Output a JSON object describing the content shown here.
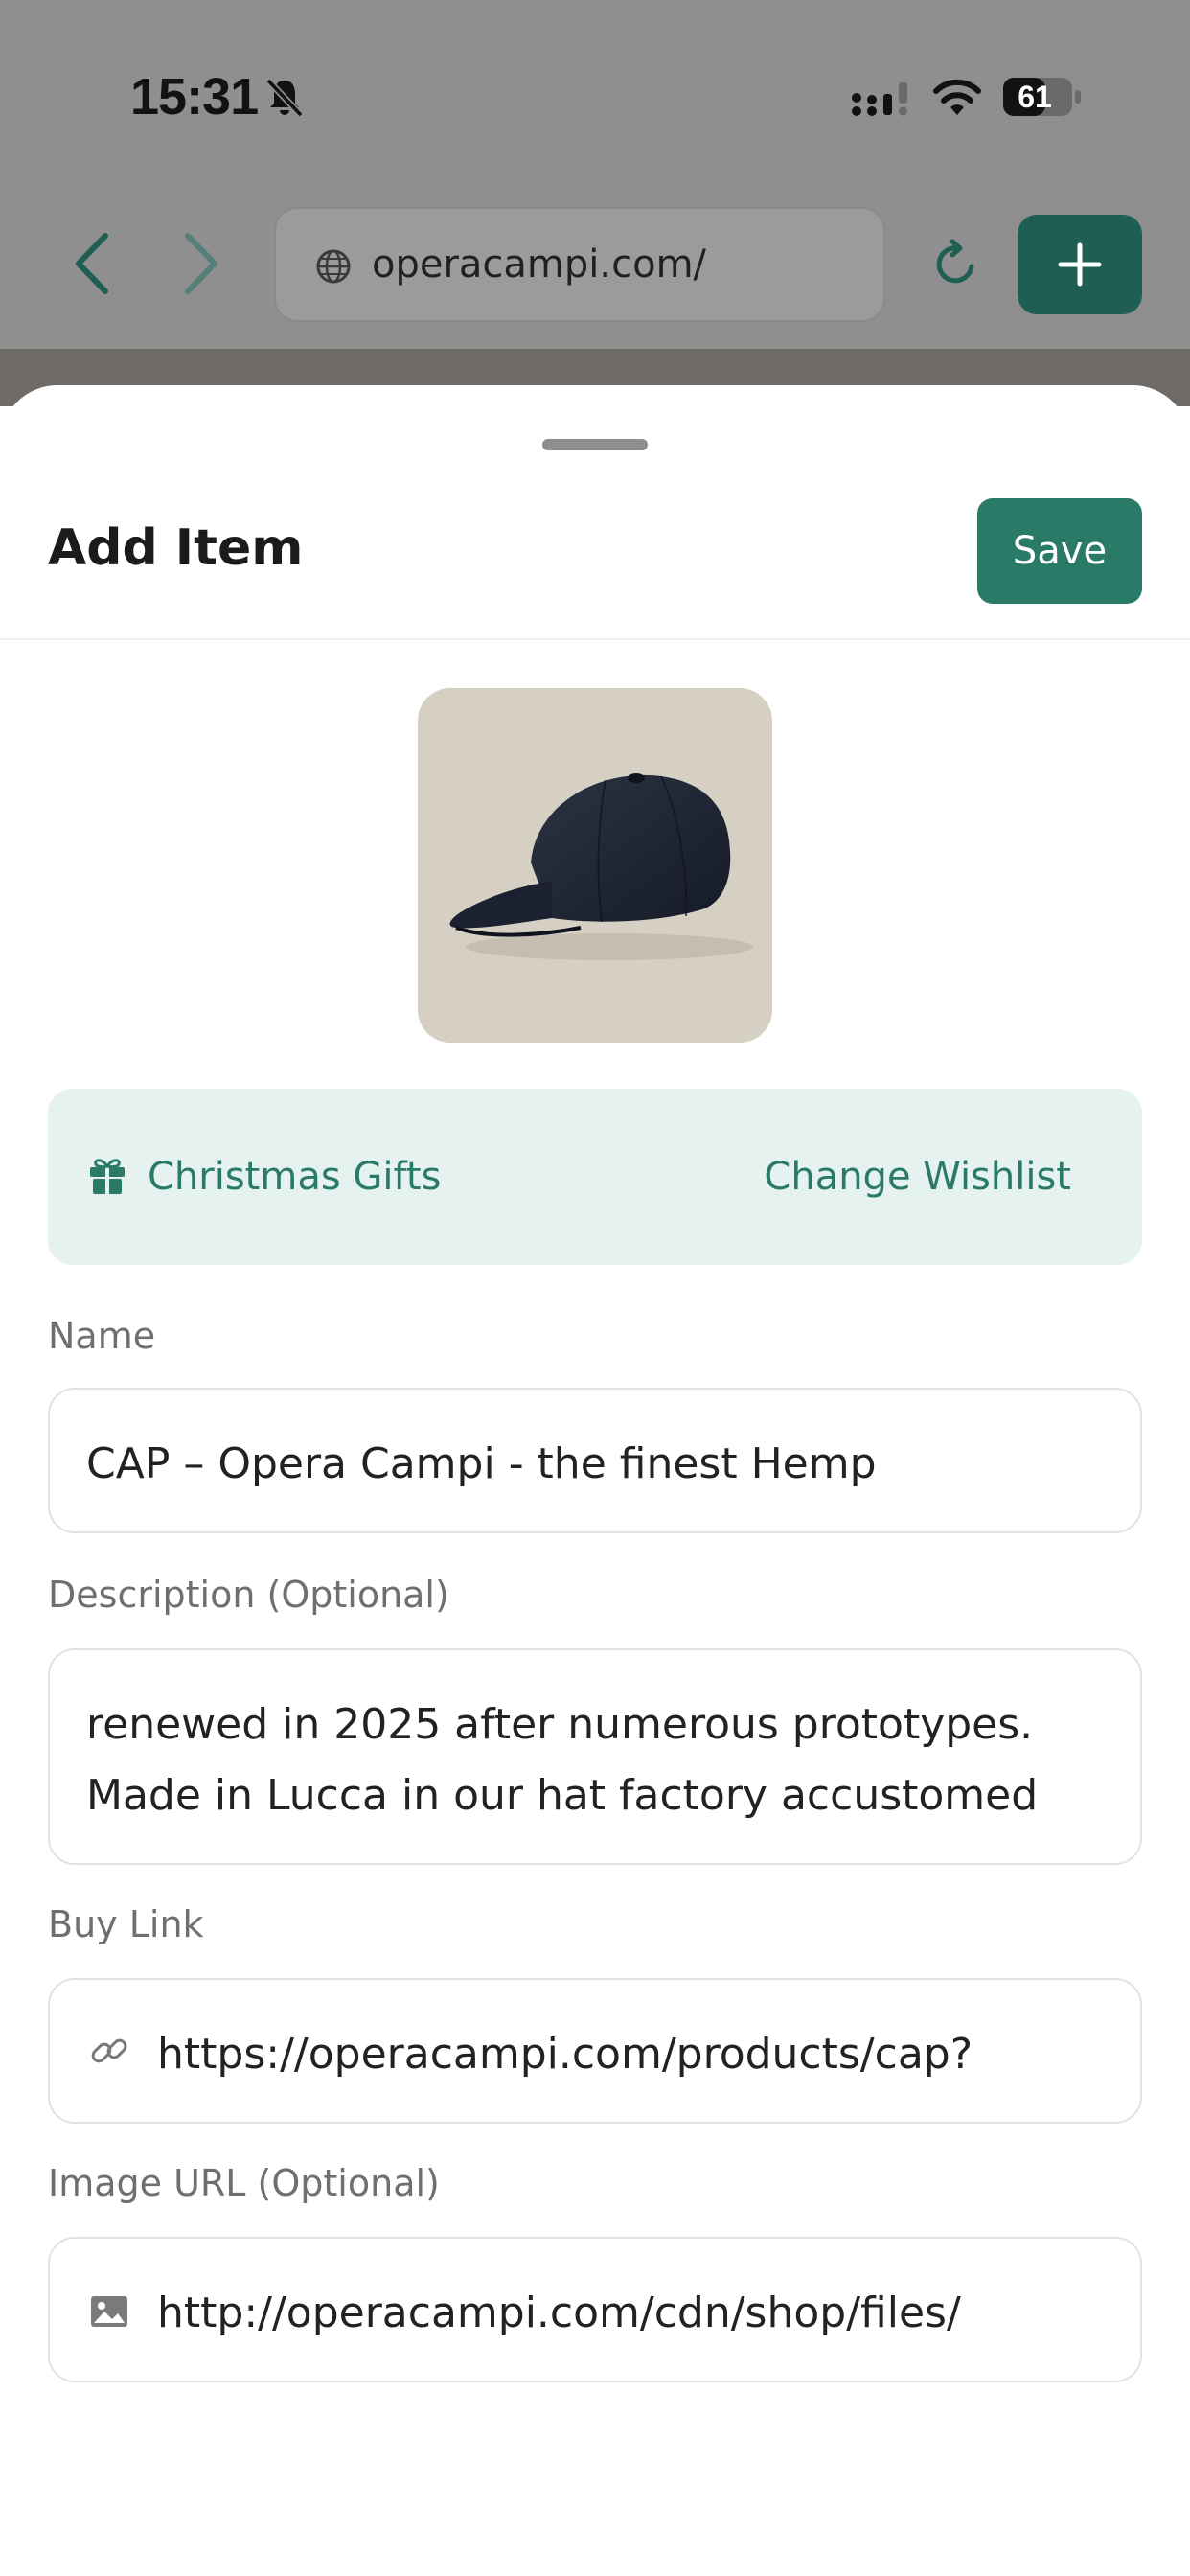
{
  "status_bar": {
    "time": "15:31",
    "battery": "61",
    "icons": [
      "bell-slash-icon",
      "signal-icon",
      "wifi-icon",
      "battery-icon"
    ]
  },
  "browser": {
    "url": "operacampi.com/",
    "icons": [
      "back-icon",
      "forward-icon",
      "globe-icon",
      "reload-icon",
      "plus-icon"
    ]
  },
  "sheet": {
    "title": "Add Item",
    "save_label": "Save"
  },
  "wishlist": {
    "name": "Christmas Gifts",
    "change_label": "Change Wishlist",
    "icon": "gift-icon"
  },
  "form": {
    "name": {
      "label": "Name",
      "value": "CAP – Opera Campi - the finest Hemp"
    },
    "description": {
      "label": "Description (Optional)",
      "line1": "renewed in 2025 after numerous prototypes.",
      "line2": "Made in Lucca in our hat factory accustomed"
    },
    "buy_link": {
      "label": "Buy Link",
      "value": "https://operacampi.com/products/cap?",
      "icon": "link-icon"
    },
    "image_url": {
      "label": "Image URL (Optional)",
      "value": "http://operacampi.com/cdn/shop/files/",
      "icon": "image-icon"
    }
  },
  "colors": {
    "accent": "#2a7a68",
    "banner_bg": "#e6f2ef",
    "dim_overlay": "#8f8f8f"
  }
}
